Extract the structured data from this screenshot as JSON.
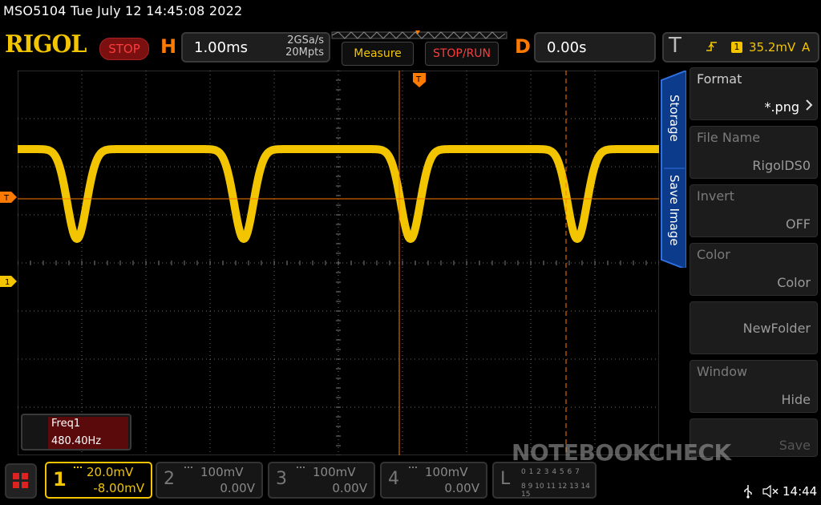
{
  "topline": "MSO5104  Tue July 12 14:45:08 2022",
  "logo": "RIGOL",
  "run_state": "STOP",
  "horizontal": {
    "letter": "H",
    "timebase": "1.00ms",
    "sample_rate": "2GSa/s",
    "memory_depth": "20Mpts"
  },
  "buttons": {
    "measure": "Measure",
    "stop_run": "STOP/RUN"
  },
  "delay": {
    "letter": "D",
    "value": "0.00s"
  },
  "trigger": {
    "letter": "T",
    "source": "1",
    "level": "35.2mV",
    "mode": "A"
  },
  "side_tabs": {
    "storage": "Storage",
    "save_image": "Save Image"
  },
  "side_menu": [
    {
      "label": "Format",
      "value": "*.png"
    },
    {
      "label": "File Name",
      "value": "RigolDS0"
    },
    {
      "label": "Invert",
      "value": "OFF"
    },
    {
      "label": "Color",
      "value": "Color"
    },
    {
      "label": "",
      "value": "NewFolder"
    },
    {
      "label": "Window",
      "value": "Hide"
    },
    {
      "label": "",
      "value": "Save"
    }
  ],
  "measurement": {
    "name": "Freq1",
    "value": "480.40Hz"
  },
  "channels": [
    {
      "num": "1",
      "scale": "20.0mV",
      "offset": "-8.00mV"
    },
    {
      "num": "2",
      "scale": "100mV",
      "offset": "0.00V"
    },
    {
      "num": "3",
      "scale": "100mV",
      "offset": "0.00V"
    },
    {
      "num": "4",
      "scale": "100mV",
      "offset": "0.00V"
    }
  ],
  "logic": {
    "letter": "L",
    "row1": "0 1 2 3 4 5 6 7",
    "row2": "8 9 10 11 12 13 14 15"
  },
  "markers": {
    "trigger_level": "T",
    "ch1": "1",
    "trig_pos": "T"
  },
  "watermark": "NOTEBOOKCHECK",
  "status_time": "14:44",
  "colors": {
    "ch1": "#f2c500",
    "trigger": "#ff7a00",
    "stop": "#ff3b3b"
  }
}
